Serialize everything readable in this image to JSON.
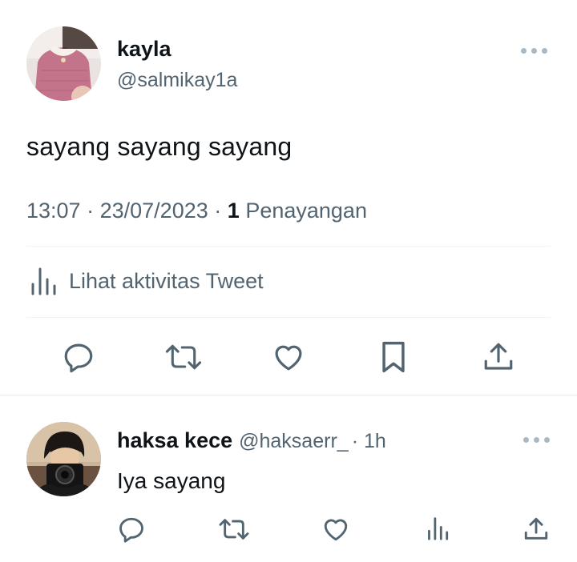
{
  "tweet": {
    "author_name": "kayla",
    "author_handle": "@salmikay1a",
    "text": "sayang sayang sayang",
    "time": "13:07",
    "date": "23/07/2023",
    "separator": "·",
    "views_count": "1",
    "views_label": "Penayangan",
    "activity_label": "Lihat aktivitas Tweet"
  },
  "reply": {
    "author_name": "haksa kece",
    "author_handle": "@haksaerr_",
    "time_ago": "· 1h",
    "text": "Iya sayang"
  },
  "icons": {
    "more": "more-horizontal-icon",
    "reply": "comment-icon",
    "retweet": "retweet-icon",
    "like": "heart-icon",
    "bookmark": "bookmark-icon",
    "share": "share-icon",
    "analytics": "analytics-icon"
  },
  "colors": {
    "text_primary": "#0f1419",
    "text_secondary": "#536471",
    "divider": "#eff3f4"
  }
}
